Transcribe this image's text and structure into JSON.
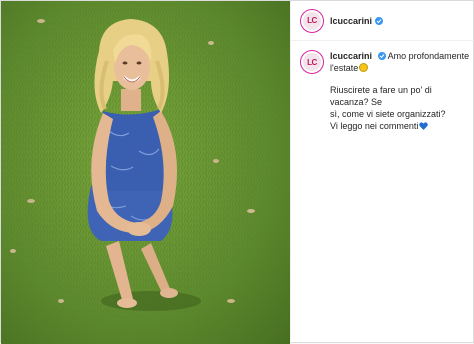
{
  "post": {
    "username": "lcuccarini",
    "avatar_initials": "LC",
    "caption": {
      "line1": "Amo profondamente",
      "line2": "l'estate",
      "line3": "Riuscirete a fare un po' di vacanza? Se",
      "line4": "sì, come vi siete organizzati?",
      "line5": "Vi leggo nei commenti"
    },
    "icons": [
      "verified-badge-icon",
      "sun-emoji-icon",
      "blue-heart-emoji-icon"
    ],
    "colors": {
      "verified": "#3897f0",
      "avatar_ring": "#d6249f",
      "grass": "#5e8a2e",
      "dress": "#3f63b5",
      "heart": "#1f6fd1"
    }
  }
}
